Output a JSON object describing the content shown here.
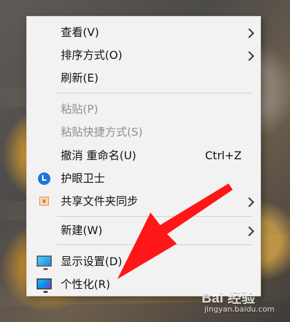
{
  "menu": {
    "items": [
      {
        "label": "查看(V)",
        "has_submenu": true
      },
      {
        "label": "排序方式(O)",
        "has_submenu": true
      },
      {
        "label": "刷新(E)",
        "has_submenu": false
      },
      {
        "label": "粘贴(P)",
        "disabled": true
      },
      {
        "label": "粘贴快捷方式(S)",
        "disabled": true
      },
      {
        "label": "撤消 重命名(U)",
        "shortcut": "Ctrl+Z"
      },
      {
        "label": "护眼卫士",
        "icon": "eye-guard-icon"
      },
      {
        "label": "共享文件夹同步",
        "icon": "share-sync-icon",
        "has_submenu": true
      },
      {
        "label": "新建(W)",
        "has_submenu": true
      },
      {
        "label": "显示设置(D)",
        "icon": "display-icon"
      },
      {
        "label": "个性化(R)",
        "icon": "personalize-icon"
      }
    ]
  },
  "watermark": {
    "logo_text": "Bai 经验",
    "subtitle": "jingyan.baidu.com"
  },
  "colors": {
    "menu_background": "#f2f2f2",
    "arrow": "#ff1616",
    "icon_blue": "#1d76df"
  }
}
